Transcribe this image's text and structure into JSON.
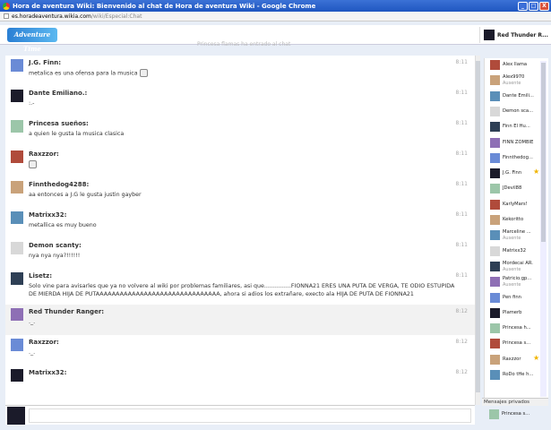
{
  "window": {
    "title": "Hora de aventura Wiki: Bienvenido al chat de Hora de aventura Wiki - Google Chrome",
    "minimize": "_",
    "maximize": "□",
    "close": "X"
  },
  "address": {
    "domain": "es.horadeaventura.wikia.com",
    "path": "/wiki/Especial:Chat"
  },
  "header": {
    "logo": "Adventure Time",
    "topic": "Princesa flamas ha entrado al chat",
    "current_user": "Red Thunder R..."
  },
  "messages": [
    {
      "name": "J.G. Finn:",
      "time": "8:11",
      "text": "metalica es una ofensa para la musica",
      "emote": true,
      "self": false
    },
    {
      "name": "Dante Emiliano.:",
      "time": "8:11",
      "text": ":.-",
      "emote": false,
      "self": false
    },
    {
      "name": "Princesa sueños:",
      "time": "8:11",
      "text": "a quien le gusta la musica clasica",
      "emote": false,
      "self": false
    },
    {
      "name": "Raxzzor:",
      "time": "8:11",
      "text": "",
      "emote": true,
      "self": false
    },
    {
      "name": "Finnthedog4288:",
      "time": "8:11",
      "text": "aa entonces a J.G le gusta justin gayber",
      "emote": false,
      "self": false
    },
    {
      "name": "Matrixx32:",
      "time": "8:11",
      "text": "metallica es muy bueno",
      "emote": false,
      "self": false
    },
    {
      "name": "Demon scanty:",
      "time": "8:11",
      "text": "nya nya nya?!!!!!!",
      "emote": false,
      "self": false
    },
    {
      "name": "Lisetz:",
      "time": "8:11",
      "text": "Solo vine para avisarles que ya no volvere al wiki por problemas familiares, asi que...............FIONNA21 ERES UNA PUTA DE VERGA, TE ODIO ESTUPIDA DE MIERDA HIJA DE PUTAAAAAAAAAAAAAAAAAAAAAAAAAAAAAAA, ahora si adios los extrañare, execto ala HIJA DE PUTA DE FIONNA21",
      "emote": false,
      "self": false
    },
    {
      "name": "Red Thunder Ranger:",
      "time": "8:12",
      "text": "._.",
      "emote": false,
      "self": true
    },
    {
      "name": "Raxzzor:",
      "time": "8:12",
      "text": "._.",
      "emote": false,
      "self": false
    },
    {
      "name": "Matrixx32:",
      "time": "8:12",
      "text": "",
      "emote": false,
      "self": false
    }
  ],
  "users": [
    {
      "name": "Alex llama",
      "status": "",
      "star": false
    },
    {
      "name": "Alex9970",
      "status": "Ausente",
      "star": false
    },
    {
      "name": "Dante Emili...",
      "status": "",
      "star": false
    },
    {
      "name": "Demon sca...",
      "status": "",
      "star": false
    },
    {
      "name": "Finn El Hu...",
      "status": "",
      "star": false
    },
    {
      "name": "FINN ZOMBIE",
      "status": "",
      "star": false
    },
    {
      "name": "Finnthedog...",
      "status": "",
      "star": false
    },
    {
      "name": "J.G. Finn",
      "status": "",
      "star": true
    },
    {
      "name": "JDevil88",
      "status": "",
      "star": false
    },
    {
      "name": "KarlyMars!",
      "status": "",
      "star": false
    },
    {
      "name": "Kekoritto",
      "status": "",
      "star": false
    },
    {
      "name": "Marceline ...",
      "status": "Ausente",
      "star": false
    },
    {
      "name": "Matrixx32",
      "status": "",
      "star": false
    },
    {
      "name": "Mordecai AR.",
      "status": "Ausente",
      "star": false
    },
    {
      "name": "Patricio.gp...",
      "status": "Ausente",
      "star": false
    },
    {
      "name": "Pen finn",
      "status": "",
      "star": false
    },
    {
      "name": "Plamerb",
      "status": "",
      "star": false
    },
    {
      "name": "Princesa h...",
      "status": "",
      "star": false
    },
    {
      "name": "Princesa s...",
      "status": "",
      "star": false
    },
    {
      "name": "Raxzzor",
      "status": "",
      "star": true
    },
    {
      "name": "RoDo tHe h...",
      "status": "",
      "star": false
    }
  ],
  "private": {
    "header": "Mensajes privados",
    "users": [
      {
        "name": "Princesa s..."
      }
    ]
  },
  "input": {
    "placeholder": ""
  }
}
